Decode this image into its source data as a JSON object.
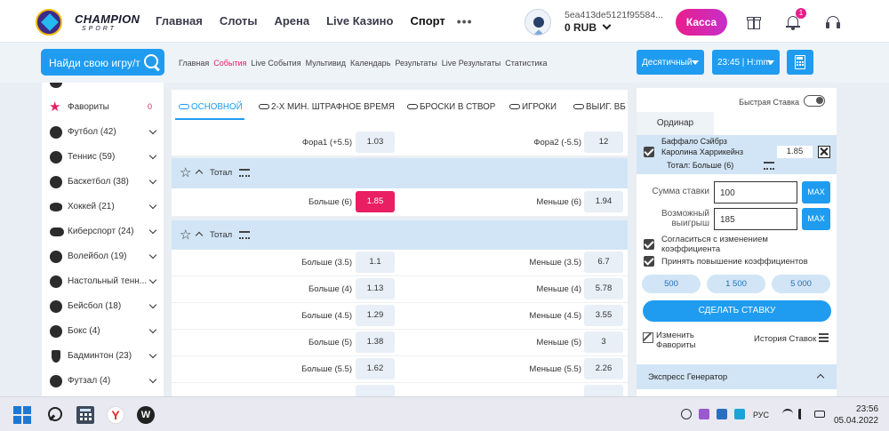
{
  "header": {
    "logo_line1": "CHAMPION",
    "logo_line2": "SPORT",
    "nav": [
      "Главная",
      "Слоты",
      "Арена",
      "Live Казино",
      "Спорт",
      "•••"
    ],
    "user_id": "5ea413de5121f95584...",
    "balance": "0 RUB",
    "kassa_label": "Касса",
    "notifications_count": "1"
  },
  "subbar": {
    "search_placeholder": "Найди свою игру/т",
    "links": [
      "Главная",
      "События",
      "Live События",
      "Мультивид",
      "Календарь",
      "Результаты",
      "Live Результаты",
      "Статистика"
    ],
    "active_link": "События",
    "odds_format": "Десятичный",
    "time_format": "23:45 | H:mm"
  },
  "sidebar": {
    "items": [
      {
        "label": "Фавориты",
        "count": "0",
        "icon": "star-icon"
      },
      {
        "label": "Футбол (42)",
        "icon": "football-icon"
      },
      {
        "label": "Теннис (59)",
        "icon": "tennis-icon"
      },
      {
        "label": "Баскетбол (38)",
        "icon": "basketball-icon"
      },
      {
        "label": "Хоккей (21)",
        "icon": "hockey-icon"
      },
      {
        "label": "Киберспорт (24)",
        "icon": "esports-icon"
      },
      {
        "label": "Волейбол (19)",
        "icon": "volleyball-icon"
      },
      {
        "label": "Настольный тенн...",
        "icon": "table-tennis-icon"
      },
      {
        "label": "Бейсбол (18)",
        "icon": "baseball-icon"
      },
      {
        "label": "Бокс (4)",
        "icon": "boxing-icon"
      },
      {
        "label": "Бадминтон (23)",
        "icon": "badminton-icon"
      },
      {
        "label": "Футзал (4)",
        "icon": "futsal-icon"
      }
    ]
  },
  "market": {
    "tabs": [
      "ОСНОВНОЙ",
      "2-Х МИН. ШТРАФНОЕ ВРЕМЯ",
      "БРОСКИ В СТВОР",
      "ИГРОКИ",
      "ВЫИГ. ВБ"
    ],
    "active_tab": "ОСНОВНОЙ",
    "fora_row": {
      "left_label": "Фора1 (+5.5)",
      "left_odd": "1.03",
      "right_label": "Фора2 (-5.5)",
      "right_odd": "12"
    },
    "group1": {
      "title": "Тотал",
      "rows": [
        {
          "left_label": "Больше (6)",
          "left_odd": "1.85",
          "right_label": "Меньше (6)",
          "right_odd": "1.94",
          "selected": "left"
        }
      ]
    },
    "group2": {
      "title": "Тотал",
      "rows": [
        {
          "left_label": "Больше (3.5)",
          "left_odd": "1.1",
          "right_label": "Меньше (3.5)",
          "right_odd": "6.7"
        },
        {
          "left_label": "Больше (4)",
          "left_odd": "1.13",
          "right_label": "Меньше (4)",
          "right_odd": "5.78"
        },
        {
          "left_label": "Больше (4.5)",
          "left_odd": "1.29",
          "right_label": "Меньше (4.5)",
          "right_odd": "3.55"
        },
        {
          "left_label": "Больше (5)",
          "left_odd": "1.38",
          "right_label": "Меньше (5)",
          "right_odd": "3"
        },
        {
          "left_label": "Больше (5.5)",
          "left_odd": "1.62",
          "right_label": "Меньше (5.5)",
          "right_odd": "2.26"
        }
      ]
    }
  },
  "betslip": {
    "quick_bet_label": "Быстрая Ставка",
    "tab_label": "Ординар",
    "bet": {
      "team1": "Баффало Сэйбрз",
      "team2": "Каролина Харрикейнз",
      "outcome": "Тотал: Больше (6)",
      "odd": "1.85"
    },
    "stake_label": "Сумма ставки",
    "stake_value": "100",
    "win_label_line1": "Возможный",
    "win_label_line2": "выигрыш",
    "win_value": "185",
    "max_label": "MAX",
    "accept_changes_line1": "Согласиться с изменением",
    "accept_changes_line2": "коэффициента",
    "accept_increase": "Принять повышение коэффициентов",
    "quick_amounts": [
      "500",
      "1 500",
      "5 000"
    ],
    "make_bet": "СДЕЛАТЬ СТАВКУ",
    "edit_fav_line1": "Изменить",
    "edit_fav_line2": "Фавориты",
    "history": "История Ставок",
    "express_generator": "Экспресс Генератор"
  },
  "taskbar": {
    "lang": "РУС",
    "time": "23:56",
    "date": "05.04.2022"
  },
  "colors": {
    "accent_blue": "#1f9cf0",
    "accent_pink": "#e91e63",
    "group_header": "#d2e5f6"
  }
}
